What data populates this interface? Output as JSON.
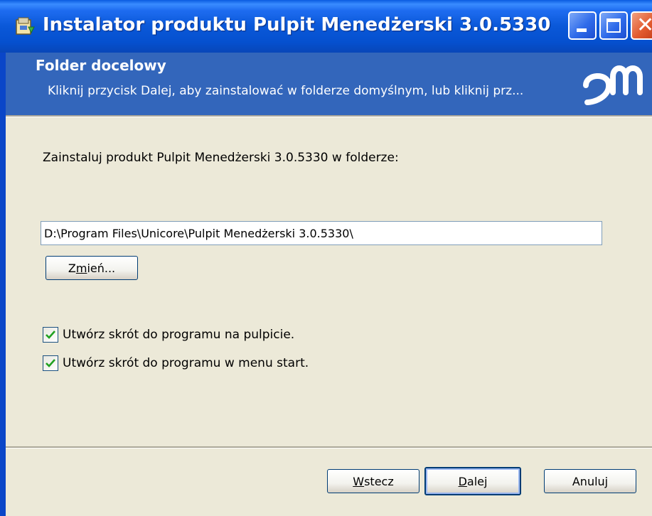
{
  "window": {
    "title": "Instalator produktu Pulpit Menedżerski 3.0.5330"
  },
  "banner": {
    "title": "Folder docelowy",
    "description": "Kliknij przycisk Dalej, aby zainstalować w folderze domyślnym, lub kliknij prz..."
  },
  "main": {
    "install_text": "Zainstaluj produkt Pulpit Menedżerski 3.0.5330 w folderze:",
    "path_value": "D:\\Program Files\\Unicore\\Pulpit Menedżerski 3.0.5330\\",
    "change_button": {
      "pre": "Z",
      "accel": "m",
      "post": "ień..."
    },
    "checkboxes": [
      {
        "label": "Utwórz skrót do programu na pulpicie.",
        "checked": true
      },
      {
        "label": "Utwórz skrót do programu w menu start.",
        "checked": true
      }
    ]
  },
  "footer": {
    "back_button": {
      "pre": "",
      "accel": "W",
      "post": "stecz"
    },
    "next_button": {
      "pre": "",
      "accel": "D",
      "post": "alej"
    },
    "cancel_button": "Anuluj"
  },
  "icons": {
    "app": "installer-icon",
    "logo": "pm-logo",
    "minimize": "minimize-icon",
    "maximize": "maximize-icon",
    "close": "close-icon",
    "check": "checkmark-icon"
  },
  "colors": {
    "titlebar": "#0A58D8",
    "banner": "#3366BB",
    "dialog_bg": "#ECE9D8",
    "close": "#E25A2E",
    "checkmark": "#21A121"
  }
}
